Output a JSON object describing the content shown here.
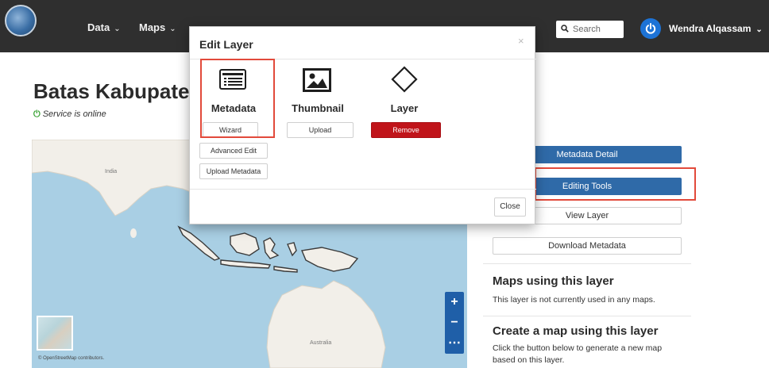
{
  "navbar": {
    "menu": [
      {
        "label": "Data",
        "icon": "chevron-down-icon"
      },
      {
        "label": "Maps",
        "icon": "chevron-down-icon"
      }
    ],
    "search": {
      "placeholder": "Search",
      "icon": "search-icon"
    },
    "user": {
      "name": "Wendra Alqassam",
      "icon": "power-icon"
    }
  },
  "page": {
    "title": "Batas Kabupaten/",
    "status": "Service is online"
  },
  "map": {
    "labels": {
      "india": "India",
      "australia": "Australia"
    },
    "controls": {
      "zoom_in": "+",
      "zoom_out": "−",
      "more": "⋯"
    },
    "attribution": "© OpenStreetMap contributors."
  },
  "modal": {
    "title": "Edit Layer",
    "close_x": "×",
    "close_button": "Close",
    "options": {
      "metadata": {
        "label": "Metadata",
        "icon": "list-icon",
        "buttons": [
          "Wizard",
          "Advanced Edit",
          "Upload Metadata"
        ]
      },
      "thumbnail": {
        "label": "Thumbnail",
        "icon": "image-icon",
        "button": "Upload"
      },
      "layer": {
        "label": "Layer",
        "icon": "diamond-icon",
        "button": "Remove"
      }
    }
  },
  "panel": {
    "buttons": {
      "metadata_detail": "Metadata Detail",
      "editing_tools": "Editing Tools",
      "view_layer": "View Layer",
      "download_metadata": "Download Metadata"
    },
    "maps_using": {
      "title": "Maps using this layer",
      "text": "This layer is not currently used in any maps."
    },
    "create_map": {
      "title": "Create a map using this layer",
      "text": "Click the button below to generate a new map based on this layer."
    }
  },
  "colors": {
    "navbar": "#2f2f2f",
    "primary": "#2f6aa8",
    "danger": "#c0141a",
    "highlight": "#e24a3b",
    "ocean": "#a9cfe4",
    "land": "#f2efe9",
    "online": "#3aa335"
  }
}
